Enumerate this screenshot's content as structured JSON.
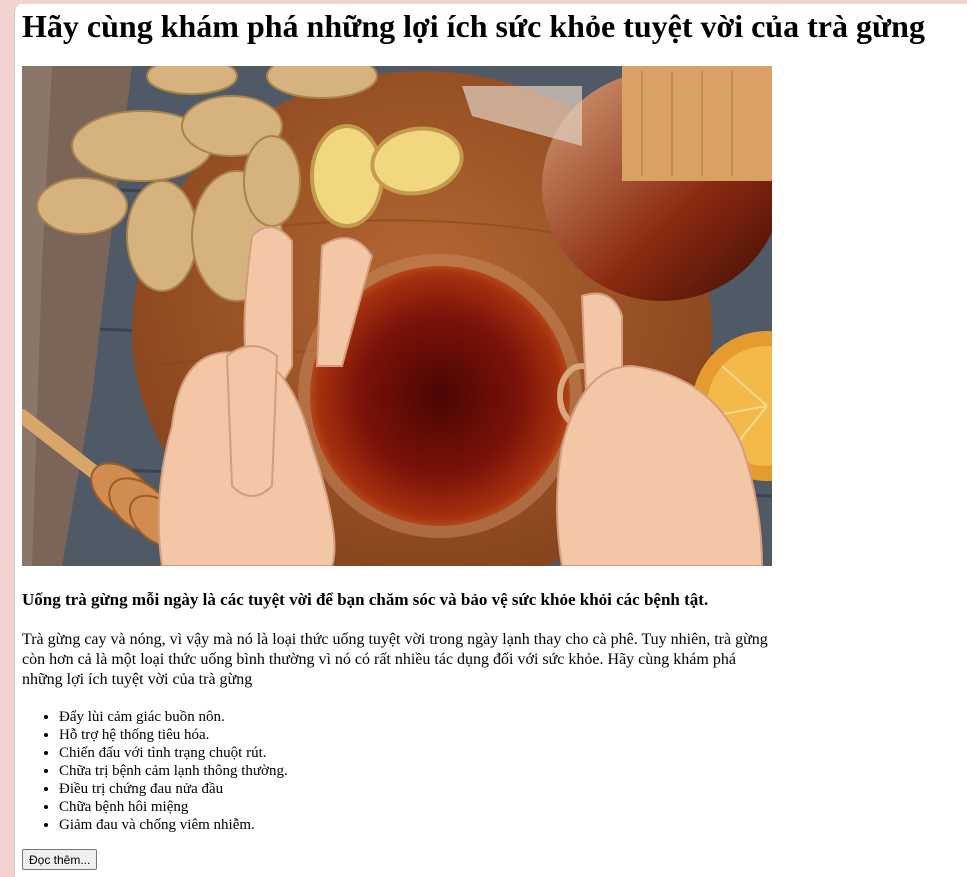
{
  "article": {
    "title": "Hãy cùng khám phá những lợi ích sức khỏe tuyệt vời của trà gừng",
    "lead": "Uống trà gừng mỗi ngày là các tuyệt vời để bạn chăm sóc và bảo vệ sức khỏe khỏi các bệnh tật.",
    "paragraph": "Trà gừng cay và nóng, vì vậy mà nó là loại thức uống tuyệt vời trong ngày lạnh thay cho cà phê. Tuy nhiên, trà gừng còn hơn cả là một loại thức uống bình thường vì nó có rất nhiều tác dụng đối với sức khỏe. Hãy cùng khám phá những lợi ích tuyệt vời của trà gừng",
    "benefits": [
      "Đẩy lùi cảm giác buồn nôn.",
      "Hỗ trợ hệ thống tiêu hóa.",
      "Chiến đấu với tình trạng chuột rút.",
      "Chữa trị bệnh cảm lạnh thông thường.",
      "Điều trị chứng đau nửa đầu",
      "Chữa bệnh hôi miệng",
      "Giảm đau và chống viêm nhiễm."
    ],
    "read_more": "Đọc thêm..."
  },
  "colors": {
    "page_background": "#f2d3cd",
    "content_background": "#ffffff",
    "tea": "#7a1208",
    "wood_board": "#a2582a",
    "ginger": "#d6b27e"
  }
}
